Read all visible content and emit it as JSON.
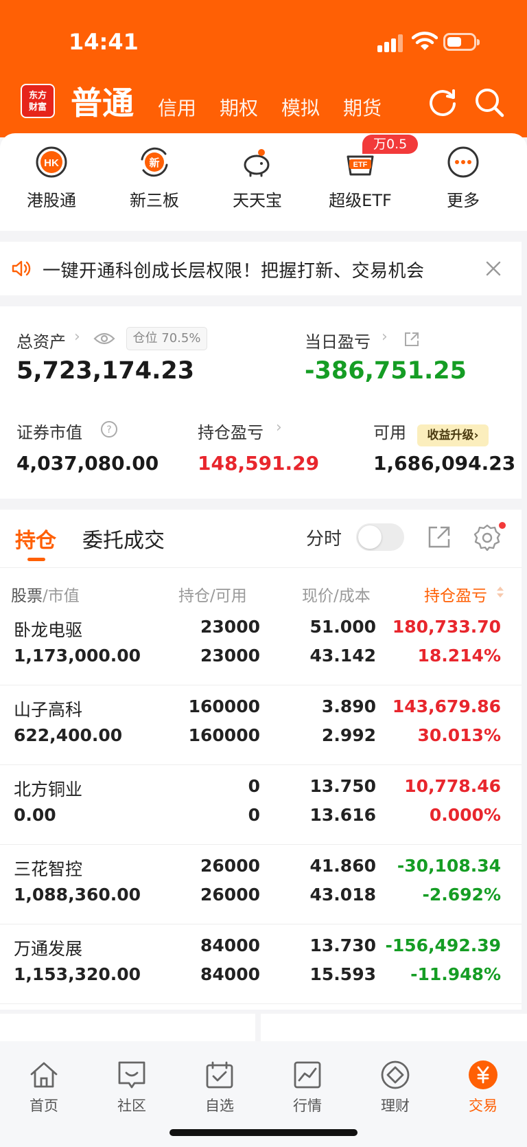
{
  "status_bar": {
    "time": "14:41"
  },
  "header": {
    "logo_text": "东方财富",
    "active_tab": "普通",
    "tabs": [
      "信用",
      "期权",
      "模拟",
      "期货"
    ],
    "icons": [
      "refresh-icon",
      "search-icon"
    ]
  },
  "shortcuts": [
    {
      "label": "港股通",
      "icon": "hk-icon"
    },
    {
      "label": "新三板",
      "icon": "new-board-icon"
    },
    {
      "label": "天天宝",
      "icon": "piggy-bank-icon"
    },
    {
      "label": "超级ETF",
      "icon": "etf-icon",
      "badge": "万0.5"
    },
    {
      "label": "更多",
      "icon": "more-icon"
    }
  ],
  "notice": {
    "text": "一键开通科创成长层权限！把握打新、交易机会"
  },
  "assets": {
    "total_label": "总资产",
    "position_label": "仓位",
    "position_value": "70.5%",
    "total_value": "5,723,174.23",
    "daily_pl_label": "当日盈亏",
    "daily_pl_value": "-386,751.25",
    "market_value_label": "证券市值",
    "market_value": "4,037,080.00",
    "holding_pl_label": "持仓盈亏",
    "holding_pl_value": "148,591.29",
    "available_label": "可用",
    "upgrade_label": "收益升级",
    "available_value": "1,686,094.23"
  },
  "holdings": {
    "tab_active": "持仓",
    "tab_other": "委托成交",
    "timeshare_label": "分时",
    "timeshare_on": false,
    "columns": {
      "stock": "股票",
      "market_value": "市值",
      "holding": "持仓",
      "available": "可用",
      "price": "现价",
      "cost": "成本",
      "pl": "持仓盈亏",
      "sep": "/"
    },
    "rows": [
      {
        "name": "卧龙电驱",
        "market_value": "1,173,000.00",
        "holding": "23000",
        "available": "23000",
        "price": "51.000",
        "cost": "43.142",
        "pl": "180,733.70",
        "pl_pct": "18.214%",
        "trend": "up"
      },
      {
        "name": "山子高科",
        "market_value": "622,400.00",
        "holding": "160000",
        "available": "160000",
        "price": "3.890",
        "cost": "2.992",
        "pl": "143,679.86",
        "pl_pct": "30.013%",
        "trend": "up"
      },
      {
        "name": "北方铜业",
        "market_value": "0.00",
        "holding": "0",
        "available": "0",
        "price": "13.750",
        "cost": "13.616",
        "pl": "10,778.46",
        "pl_pct": "0.000%",
        "trend": "up"
      },
      {
        "name": "三花智控",
        "market_value": "1,088,360.00",
        "holding": "26000",
        "available": "26000",
        "price": "41.860",
        "cost": "43.018",
        "pl": "-30,108.34",
        "pl_pct": "-2.692%",
        "trend": "down"
      },
      {
        "name": "万通发展",
        "market_value": "1,153,320.00",
        "holding": "84000",
        "available": "84000",
        "price": "13.730",
        "cost": "15.593",
        "pl": "-156,492.39",
        "pl_pct": "-11.948%",
        "trend": "down"
      }
    ]
  },
  "bottom_nav": [
    {
      "label": "首页",
      "icon": "home-icon",
      "active": false
    },
    {
      "label": "社区",
      "icon": "community-icon",
      "active": false
    },
    {
      "label": "自选",
      "icon": "watchlist-icon",
      "active": false
    },
    {
      "label": "行情",
      "icon": "market-icon",
      "active": false
    },
    {
      "label": "理财",
      "icon": "wealth-icon",
      "active": false
    },
    {
      "label": "交易",
      "icon": "trade-icon",
      "active": true
    }
  ],
  "colors": {
    "brand": "#ff6005",
    "up": "#e8262d",
    "down": "#159d24",
    "badge": "#f23a3a"
  }
}
